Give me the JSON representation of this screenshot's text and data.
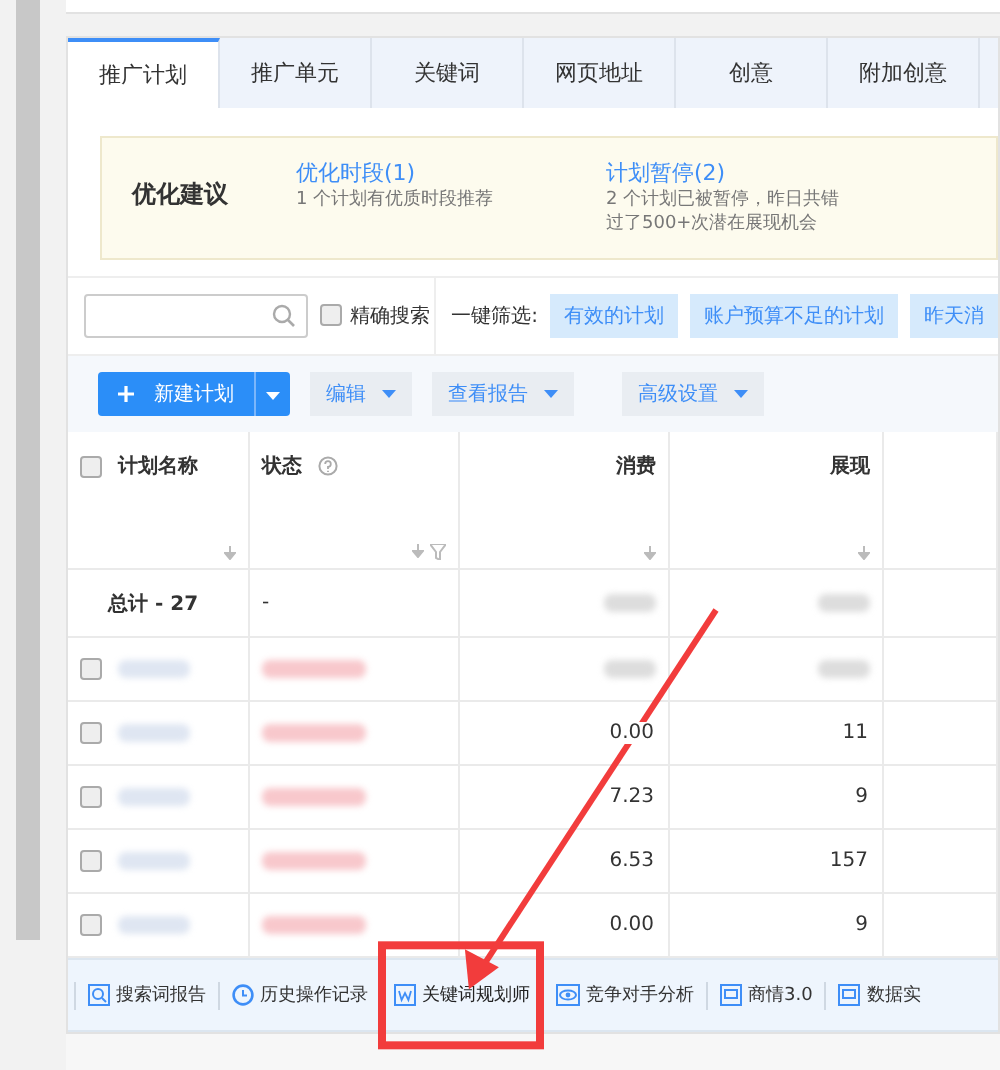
{
  "tabs": [
    {
      "label": "推广计划",
      "selected": true
    },
    {
      "label": "推广单元",
      "selected": false
    },
    {
      "label": "关键词",
      "selected": false
    },
    {
      "label": "网页地址",
      "selected": false
    },
    {
      "label": "创意",
      "selected": false
    },
    {
      "label": "附加创意",
      "selected": false
    }
  ],
  "suggestions": {
    "title": "优化建议",
    "items": [
      {
        "link": "优化时段(1)",
        "lines": [
          "1 个计划有优质时段推荐"
        ]
      },
      {
        "link": "计划暂停(2)",
        "lines": [
          "2 个计划已被暂停，昨日共错",
          "过了500+次潜在展现机会"
        ]
      }
    ]
  },
  "search": {
    "exact_label": "精确搜索",
    "exact_checked": false
  },
  "quick_filter": {
    "label": "一键筛选:",
    "chips": [
      "有效的计划",
      "账户预算不足的计划",
      "昨天消"
    ]
  },
  "toolbar": {
    "new_button": "新建计划",
    "menus": [
      "编辑",
      "查看报告",
      "高级设置"
    ]
  },
  "table": {
    "select_all_checked": false,
    "columns": [
      "计划名称",
      "状态",
      "消费",
      "展现"
    ],
    "total_label": "总计 - 27",
    "total_status": "-",
    "rows": [
      {
        "checked": false,
        "spend": "",
        "impressions": ""
      },
      {
        "checked": false,
        "spend": "0.00",
        "impressions": "11"
      },
      {
        "checked": false,
        "spend": "7.23",
        "impressions": "9"
      },
      {
        "checked": false,
        "spend": "6.53",
        "impressions": "157"
      },
      {
        "checked": false,
        "spend": "0.00",
        "impressions": "9"
      }
    ]
  },
  "bottom_bar": [
    {
      "label": "搜索词报告",
      "kind": "search",
      "highlighted": false
    },
    {
      "label": "历史操作记录",
      "kind": "clock",
      "highlighted": false
    },
    {
      "label": "关键词规划师",
      "kind": "doc",
      "highlighted": true
    },
    {
      "label": "竞争对手分析",
      "kind": "eye",
      "highlighted": false
    },
    {
      "label": "商情3.0",
      "kind": "screen",
      "highlighted": false
    },
    {
      "label": "数据实",
      "kind": "screen",
      "highlighted": false
    }
  ]
}
